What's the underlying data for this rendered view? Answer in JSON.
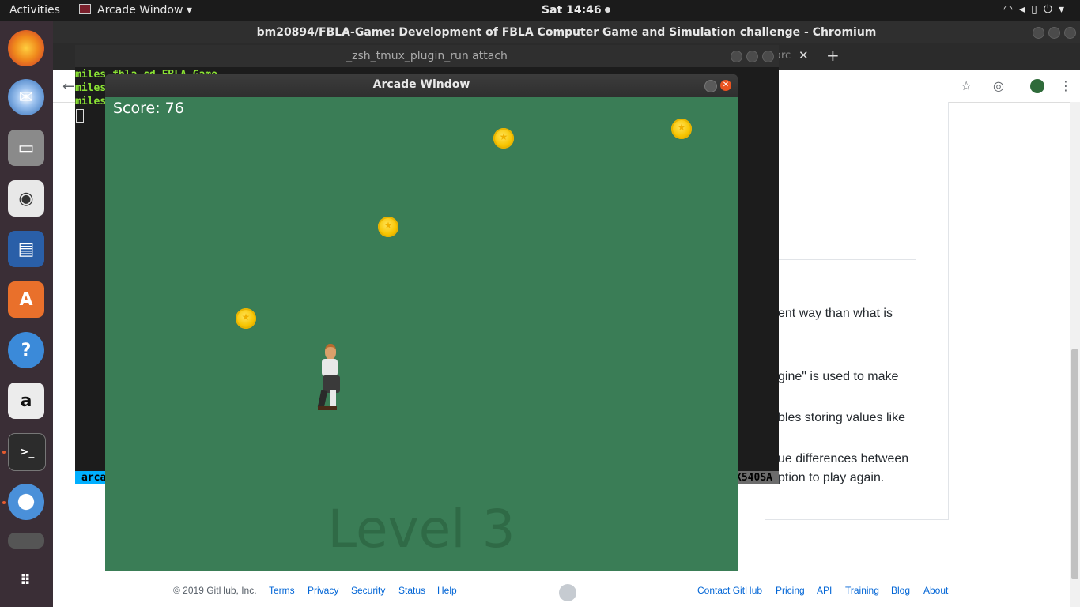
{
  "topbar": {
    "activities": "Activities",
    "app_menu": "Arcade Window ▾",
    "clock": "Sat 14:46",
    "system_icons": "wifi-icon volume-icon battery-icon power-icon"
  },
  "dock": {
    "items": [
      {
        "name": "firefox-icon",
        "color": "#e66000"
      },
      {
        "name": "thunderbird-icon",
        "color": "#2a6ab8"
      },
      {
        "name": "files-icon",
        "color": "#8a8a8a"
      },
      {
        "name": "rhythmbox-icon",
        "color": "#c9a227"
      },
      {
        "name": "writer-icon",
        "color": "#2a5fa8"
      },
      {
        "name": "software-center-icon",
        "color": "#e9702b"
      },
      {
        "name": "help-icon",
        "color": "#3b8ad9"
      },
      {
        "name": "amazon-icon",
        "color": "#ececec"
      },
      {
        "name": "terminal-icon",
        "color": "#2c2c2c"
      },
      {
        "name": "chromium-icon",
        "color": "#4a90d9"
      },
      {
        "name": "screenshot-icon",
        "color": "#555555"
      }
    ],
    "apps_grid_icon": "show-applications-icon"
  },
  "chromium": {
    "title": "bm20894/FBLA-Game: Development of FBLA Computer Game and Simulation challenge - Chromium",
    "tab_partial": "arc",
    "visible_text": [
      "ent way than what is",
      "gine\" is used to make",
      "bles storing values like",
      "ue differences between",
      "ption to play again."
    ],
    "footer": {
      "copyright": "© 2019 GitHub, Inc.",
      "left_links": [
        "Terms",
        "Privacy",
        "Security",
        "Status",
        "Help"
      ],
      "right_links": [
        "Contact GitHub",
        "Pricing",
        "API",
        "Training",
        "Blog",
        "About"
      ]
    }
  },
  "terminal": {
    "title": "_zsh_tmux_plugin_run attach",
    "lines": [
      "miles  fbla  cd FBLA-Game",
      "miles",
      "miles"
    ],
    "status_left": "arca",
    "status_right": "X540SA"
  },
  "arcade": {
    "title": "Arcade Window",
    "score": "Score: 76",
    "level": "Level 3"
  }
}
